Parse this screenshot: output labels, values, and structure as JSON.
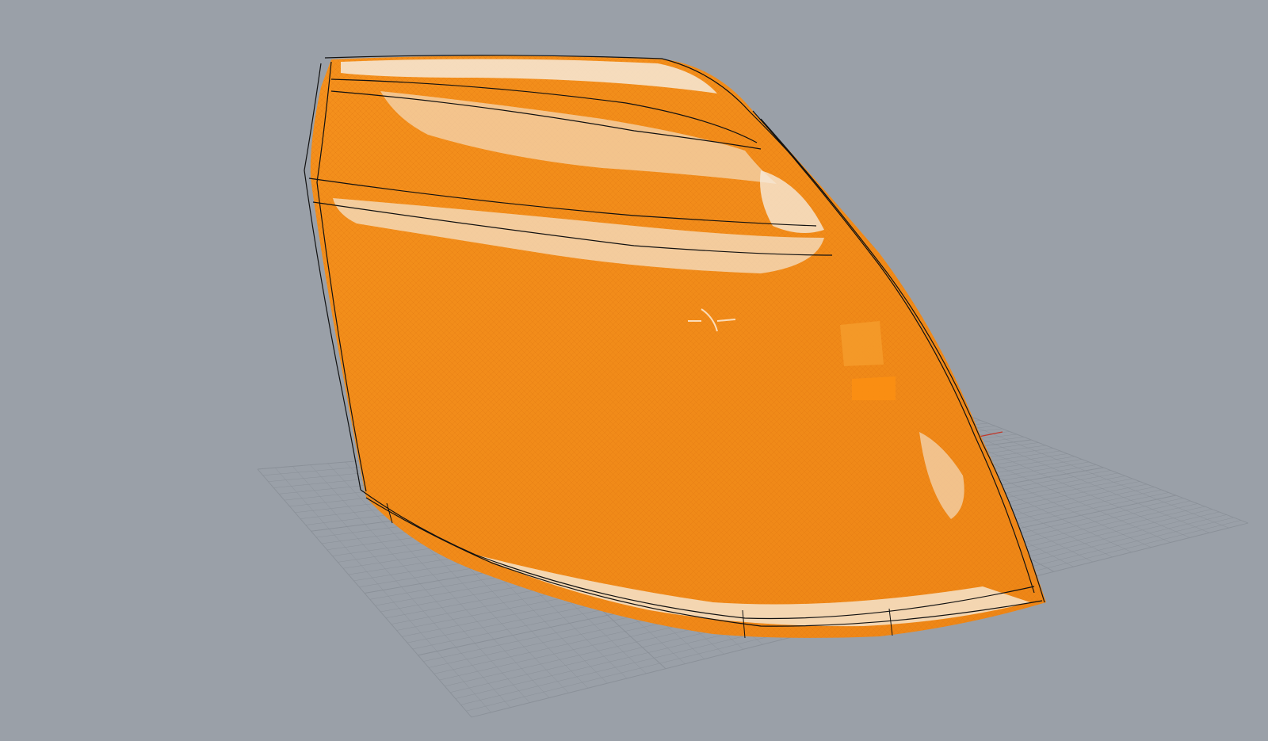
{
  "viewport": {
    "background_color": "#9aa0a8",
    "grid_color": "#8a9098",
    "grid_x_axis_color": "#c0392b",
    "grid_y_axis_color": "#2e8b57",
    "mesh_color": "#f28a1a",
    "mesh_highlight_color": "#f4e7d8",
    "curve_color": "#111111"
  },
  "objects": [
    {
      "name": "construction-plane-grid",
      "visible": true
    },
    {
      "name": "headlamp-lens-mesh",
      "visible": true
    },
    {
      "name": "surface-edge-curves",
      "visible": true
    },
    {
      "name": "world-axes-gizmo",
      "visible": true
    }
  ]
}
